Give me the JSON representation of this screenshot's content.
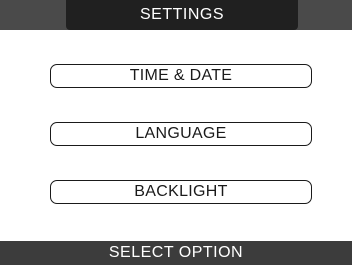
{
  "header": {
    "title": "SETTINGS"
  },
  "menu": {
    "items": [
      {
        "label": "TIME & DATE"
      },
      {
        "label": "LANGUAGE"
      },
      {
        "label": "BACKLIGHT"
      }
    ]
  },
  "footer": {
    "status": "SELECT OPTION"
  },
  "colors": {
    "header_band": "#4a4a4a",
    "header_tab": "#202020",
    "footer_band": "#3c3c3c",
    "background": "#ffffff",
    "outline": "#1a1a1a"
  }
}
